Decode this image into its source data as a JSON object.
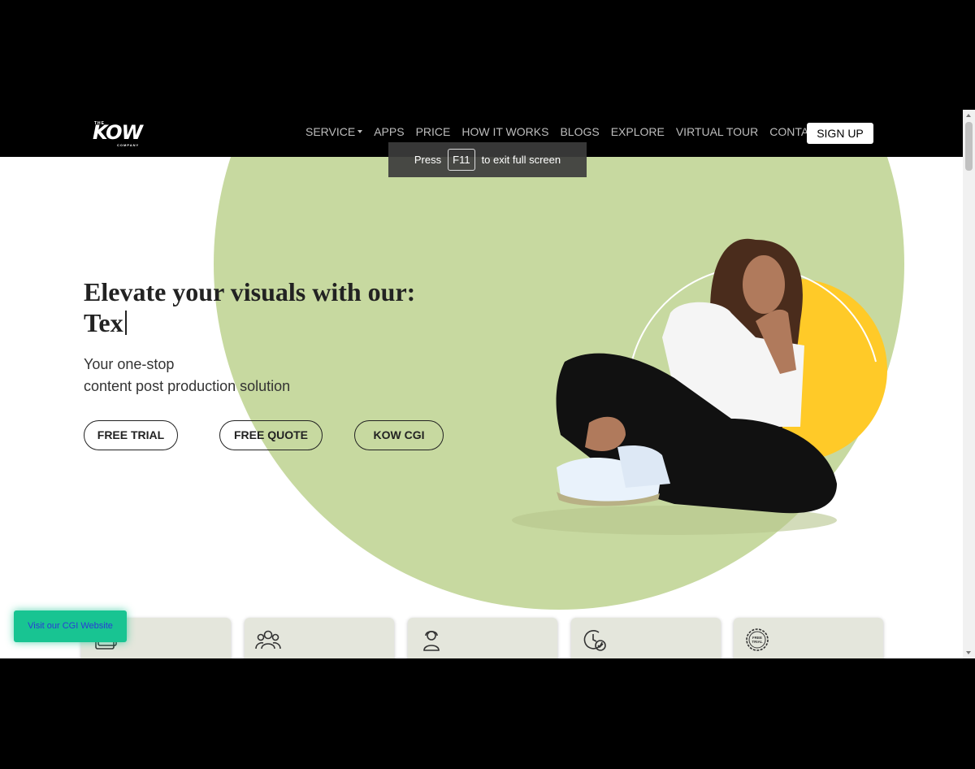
{
  "nav": {
    "logo": {
      "the": "THE",
      "name": "KOW",
      "company": "COMPANY"
    },
    "items": [
      {
        "label": "SERVICE",
        "dropdown": true
      },
      {
        "label": "APPS"
      },
      {
        "label": "PRICE"
      },
      {
        "label": "HOW IT WORKS"
      },
      {
        "label": "BLOGS"
      },
      {
        "label": "EXPLORE"
      },
      {
        "label": "VIRTUAL TOUR"
      },
      {
        "label": "CONTACT"
      }
    ],
    "signup_label": "SIGN UP"
  },
  "fullscreen_notice": {
    "before": "Press",
    "key": "F11",
    "after": "to exit full screen"
  },
  "hero": {
    "title_line1": "Elevate your visuals with our:",
    "typed_text": "Tex",
    "subtitle_line1": "Your one-stop",
    "subtitle_line2": "content post production solution",
    "buttons": {
      "trial": "FREE TRIAL",
      "quote": "FREE QUOTE",
      "cgi": "KOW CGI"
    }
  },
  "cards": [
    {
      "icon": "image-stack-icon"
    },
    {
      "icon": "team-icon"
    },
    {
      "icon": "support-agent-icon"
    },
    {
      "icon": "clock-check-icon"
    },
    {
      "icon": "free-trial-badge-icon",
      "badge_text": "FREE TRIAL"
    }
  ],
  "floating": {
    "cgi_website_label": "Visit our CGI Website"
  },
  "colors": {
    "accent_green": "#c7d9a0",
    "accent_yellow": "#ffca28",
    "cta_green": "#18c492",
    "nav_bg": "#000000"
  }
}
